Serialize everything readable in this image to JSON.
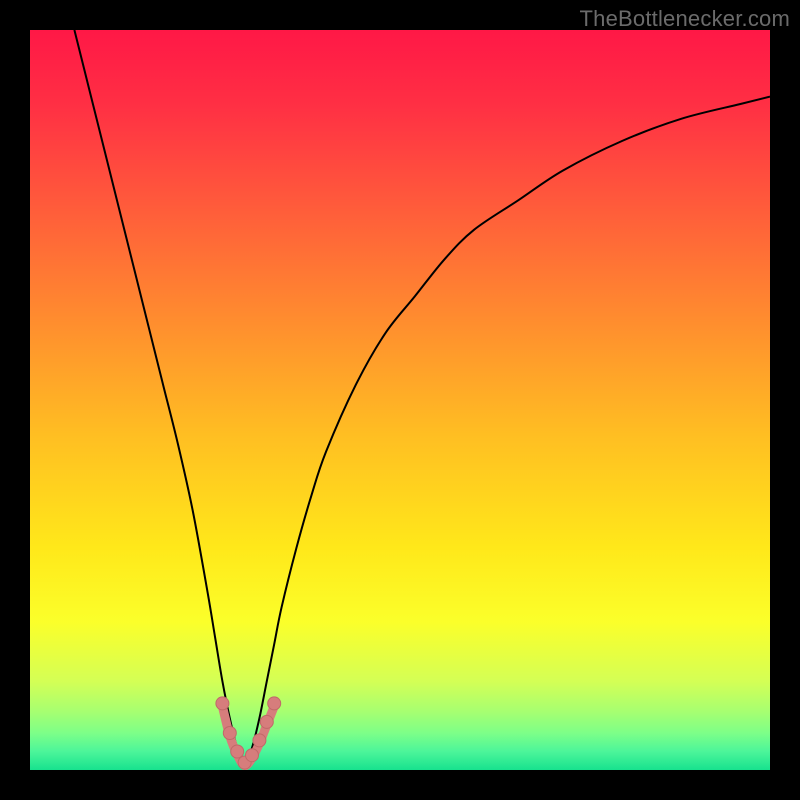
{
  "watermark": {
    "text": "TheBottlenecker.com"
  },
  "colors": {
    "background": "#000000",
    "curve": "#000000",
    "marker_fill": "#d67d7c",
    "marker_stroke": "#c06969",
    "gradient_stops": [
      {
        "offset": 0.0,
        "color": "#ff1846"
      },
      {
        "offset": 0.1,
        "color": "#ff2f44"
      },
      {
        "offset": 0.25,
        "color": "#ff5f3a"
      },
      {
        "offset": 0.4,
        "color": "#ff8f2e"
      },
      {
        "offset": 0.55,
        "color": "#ffbf22"
      },
      {
        "offset": 0.7,
        "color": "#ffe81a"
      },
      {
        "offset": 0.8,
        "color": "#fbff2a"
      },
      {
        "offset": 0.88,
        "color": "#d4ff55"
      },
      {
        "offset": 0.92,
        "color": "#a8ff70"
      },
      {
        "offset": 0.95,
        "color": "#7dff88"
      },
      {
        "offset": 0.975,
        "color": "#4cf59a"
      },
      {
        "offset": 1.0,
        "color": "#17e28e"
      }
    ]
  },
  "chart_data": {
    "type": "line",
    "title": "",
    "xlabel": "",
    "ylabel": "",
    "xlim": [
      0,
      100
    ],
    "ylim": [
      0,
      100
    ],
    "x_at_minimum": 29,
    "series": [
      {
        "name": "bottleneck-curve",
        "x": [
          6,
          8,
          10,
          12,
          14,
          16,
          18,
          20,
          22,
          24,
          25,
          26,
          27,
          28,
          29,
          30,
          31,
          32,
          33,
          34,
          36,
          38,
          40,
          44,
          48,
          52,
          56,
          60,
          66,
          72,
          80,
          88,
          96,
          100
        ],
        "y": [
          100,
          92,
          84,
          76,
          68,
          60,
          52,
          44,
          35,
          24,
          18,
          12,
          7,
          3,
          1,
          3,
          7,
          12,
          17,
          22,
          30,
          37,
          43,
          52,
          59,
          64,
          69,
          73,
          77,
          81,
          85,
          88,
          90,
          91
        ]
      }
    ],
    "markers": {
      "name": "optimal-region-markers",
      "x": [
        26,
        27,
        28,
        29,
        30,
        31,
        32,
        33
      ],
      "y": [
        9,
        5,
        2.5,
        1,
        2,
        4,
        6.5,
        9
      ]
    }
  }
}
